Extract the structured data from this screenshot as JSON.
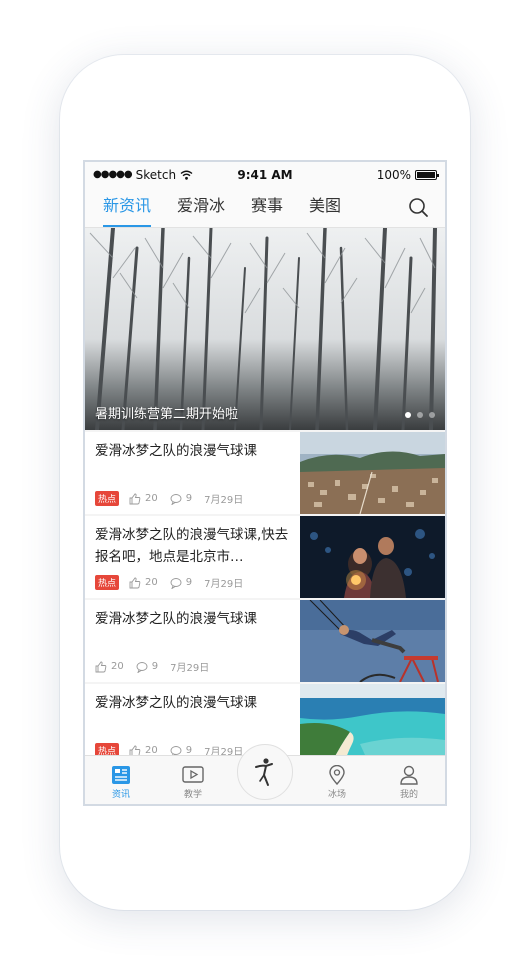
{
  "status_bar": {
    "carrier": "Sketch",
    "time": "9:41 AM",
    "battery": "100%"
  },
  "tabs": [
    {
      "label": "新资讯",
      "active": true
    },
    {
      "label": "爱滑冰",
      "active": false
    },
    {
      "label": "赛事",
      "active": false
    },
    {
      "label": "美图",
      "active": false
    }
  ],
  "banner": {
    "caption": "暑期训练营第二期开始啦",
    "dots": 3,
    "active_dot": 0
  },
  "news": [
    {
      "title": "爱滑冰梦之队的浪漫气球课",
      "hot": "热点",
      "likes": "20",
      "comments": "9",
      "date": "7月29日",
      "thumb": "city-aerial"
    },
    {
      "title": "爱滑冰梦之队的浪漫气球课,快去报名吧，地点是北京市…",
      "hot": "热点",
      "likes": "20",
      "comments": "9",
      "date": "7月29日",
      "thumb": "couple-sparkler"
    },
    {
      "title": "爱滑冰梦之队的浪漫气球课",
      "hot": "",
      "likes": "20",
      "comments": "9",
      "date": "7月29日",
      "thumb": "boy-swing"
    },
    {
      "title": "爱滑冰梦之队的浪漫气球课",
      "hot": "热点",
      "likes": "20",
      "comments": "9",
      "date": "7月29日",
      "thumb": "beach-aerial"
    }
  ],
  "bottom_nav": [
    {
      "label": "资讯",
      "icon": "news-icon",
      "active": true
    },
    {
      "label": "教学",
      "icon": "video-icon",
      "active": false
    },
    {
      "label": "",
      "icon": "skater-icon",
      "active": false
    },
    {
      "label": "冰场",
      "icon": "location-icon",
      "active": false
    },
    {
      "label": "我的",
      "icon": "user-icon",
      "active": false
    }
  ],
  "colors": {
    "accent": "#2a97e6",
    "hot": "#e6473a"
  }
}
